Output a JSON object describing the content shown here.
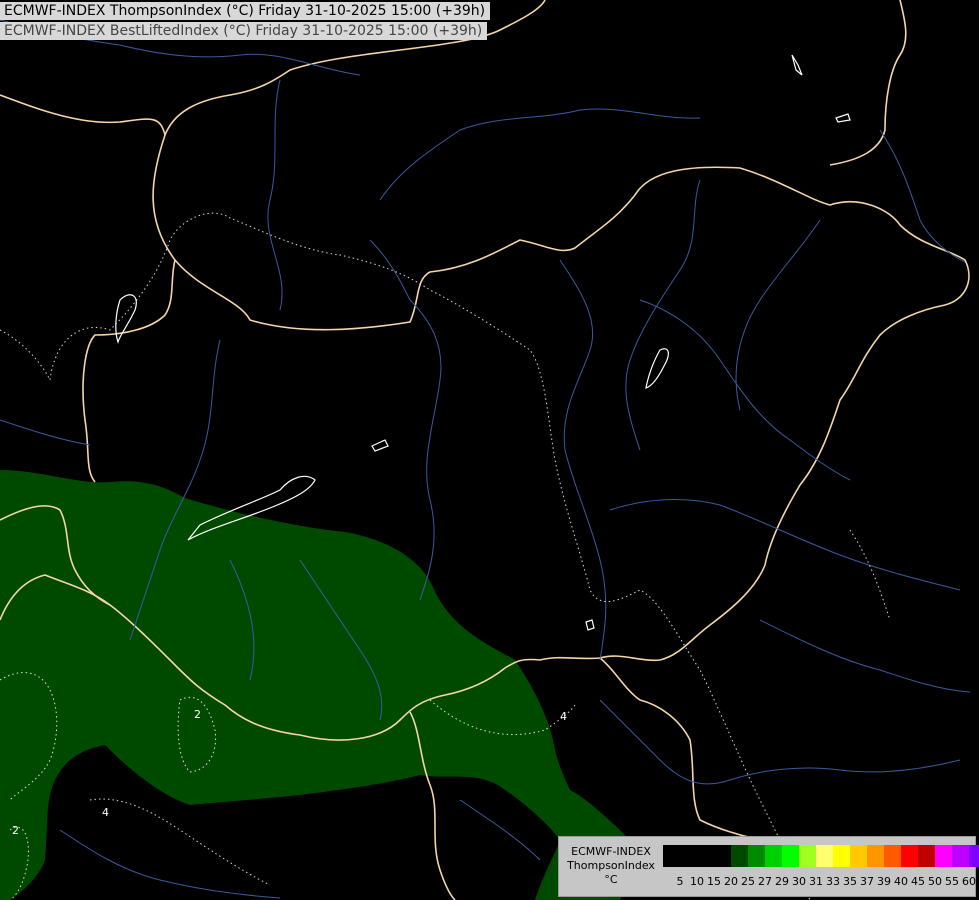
{
  "titles": {
    "primary": "ECMWF-INDEX ThompsonIndex (°C) Friday 31-10-2025 15:00 (+39h)",
    "secondary": "ECMWF-INDEX BestLiftedIndex (°C) Friday 31-10-2025 15:00 (+39h)"
  },
  "legend": {
    "line1": "ECMWF-INDEX",
    "line2": "ThompsonIndex",
    "unit": "°C",
    "colors": [
      "#000000",
      "#000000",
      "#000000",
      "#000000",
      "#004a00",
      "#008a00",
      "#00d000",
      "#00ff00",
      "#a0ff20",
      "#ffff70",
      "#ffff00",
      "#ffc800",
      "#ff9600",
      "#ff5a00",
      "#ff0000",
      "#c00000",
      "#ff00ff",
      "#c000ff",
      "#8000ff",
      "#4040ff",
      "#0000ff"
    ],
    "ticks": [
      "5",
      "10",
      "15",
      "20",
      "25",
      "27",
      "29",
      "30",
      "31",
      "33",
      "35",
      "37",
      "39",
      "40",
      "45",
      "50",
      "55",
      "60"
    ]
  },
  "map": {
    "fill_color": "#004a00",
    "contour_labels": [
      "2",
      "2",
      "4",
      "4"
    ]
  }
}
